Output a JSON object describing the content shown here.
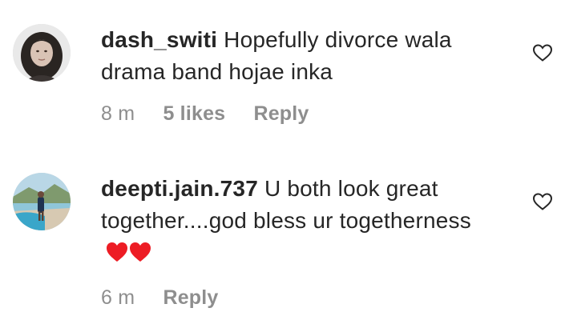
{
  "comments": [
    {
      "username": "dash_switi",
      "text": "Hopefully divorce wala drama band hojae inka",
      "time": "8 m",
      "likes": "5 likes",
      "reply_label": "Reply",
      "avatar_icon": "profile-photo-woman",
      "like_icon": "heart-outline-icon"
    },
    {
      "username": "deepti.jain.737",
      "text": "U both look great together....god bless ur togetherness",
      "emoji": "❤️❤️",
      "time": "6 m",
      "reply_label": "Reply",
      "avatar_icon": "profile-photo-beach",
      "like_icon": "heart-outline-icon"
    }
  ],
  "colors": {
    "text": "#262626",
    "secondary": "#8e8e8e",
    "heart_red": "#ed1c24"
  }
}
